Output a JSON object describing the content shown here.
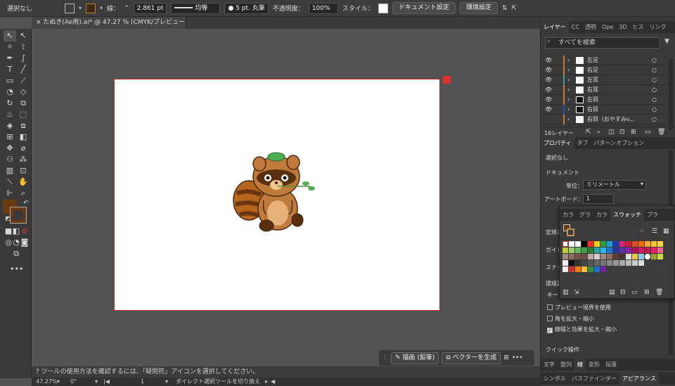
{
  "control_bar": {
    "selection": "選択なし",
    "fill_color": "#6a3a10",
    "stroke_label": "線：",
    "stroke_weight": "2.861 pt",
    "stroke_profile": "均等",
    "brush": "5 pt. 丸筆",
    "opacity_label": "不透明度：",
    "opacity": "100%",
    "style_label": "スタイル：",
    "doc_settings": "ドキュメント設定",
    "preferences": "環境設定"
  },
  "document": {
    "tab_title": "たぬき(Ae用).ai* @ 47.27 % (CMYK/プレビュー)",
    "close": "×"
  },
  "tools": {
    "fill_color": "#6a3a10",
    "stroke_color": "#6a3a10",
    "more": "•••"
  },
  "float_bar": {
    "draw_label": "描画 (鉛筆)",
    "vector_label": "ベクターを生成",
    "more": "•••"
  },
  "tooltip": "ツールの使用方法を確認するには、「疑問符」アイコンを選択してください。",
  "status": {
    "zoom": "47.27%",
    "rotation": "0°",
    "artboard_num": "1",
    "tool_name": "ダイレクト選択ツールを切り換え"
  },
  "layers_panel": {
    "tabs": [
      "レイヤー",
      "CC",
      "透明",
      "Ope",
      "3D",
      "ヒス",
      "リンク"
    ],
    "search_placeholder": "すべてを検索",
    "rows": [
      {
        "name": "左足",
        "color": "#c97a2e"
      },
      {
        "name": "右足",
        "color": "#c97a2e"
      },
      {
        "name": "左耳",
        "color": "#3ba0a0"
      },
      {
        "name": "右耳",
        "color": "#c97a2e"
      },
      {
        "name": "左目",
        "color": "#c97a2e"
      },
      {
        "name": "右目",
        "color": "#1f4fbf"
      },
      {
        "name": "右目（おやすみv...",
        "color": "#c97a2e"
      }
    ],
    "count": "16レイヤー"
  },
  "properties_panel": {
    "tabs": [
      "プロパティ",
      "タブ",
      "パターンオプション"
    ],
    "selection": "選択なし",
    "document_header": "ドキュメント",
    "unit_label": "単位：",
    "unit_value": "ミリメートル",
    "artboard_label": "アートボード：",
    "artboard_value": "1",
    "ruler_label": "定規と",
    "guide_label": "ガイド",
    "snap_label": "スナッ",
    "env_label": "環境設",
    "key_label": "キー",
    "checkbox_preview_bounds": "プレビュー境界を使用",
    "checkbox_scale_corners": "角を拡大・縮小",
    "checkbox_scale_strokes": "線幅と効果を拡大・縮小",
    "quick_actions": "クイック操作"
  },
  "swatch_panel": {
    "tabs": [
      "カラ",
      "グラ",
      "カラ",
      "スウォッチ",
      "ブラ"
    ]
  },
  "bottom_tabs_1": [
    "文字",
    "整列",
    "線",
    "変形",
    "段落"
  ],
  "bottom_tabs_2": [
    "シンボル",
    "パスファインダー",
    "アピアランス"
  ]
}
